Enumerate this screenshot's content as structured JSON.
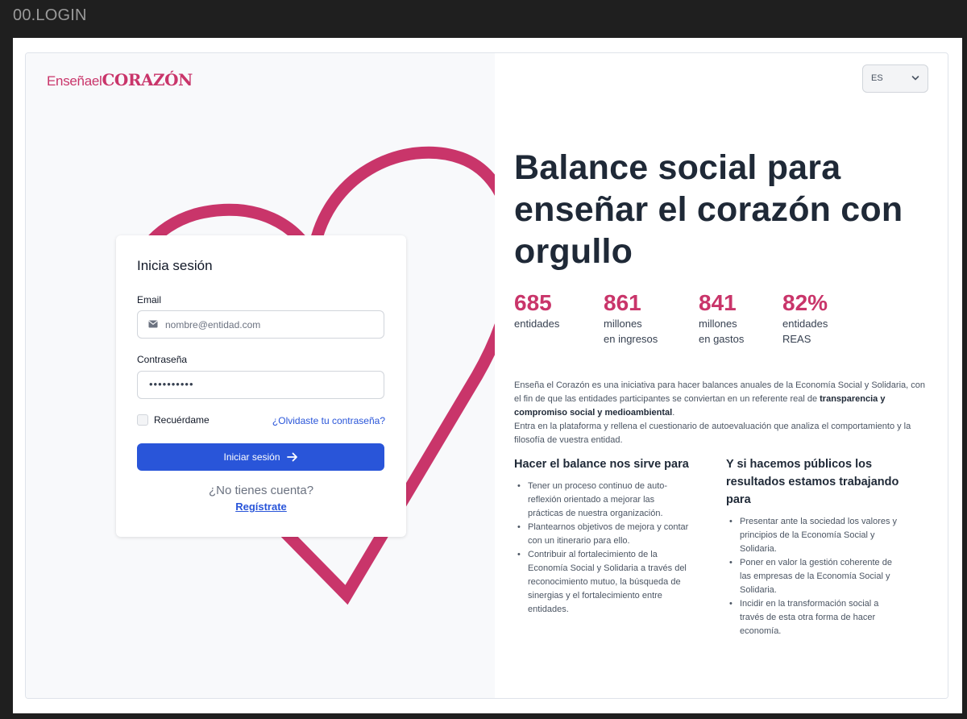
{
  "frame": {
    "title": "00.LOGIN"
  },
  "brand": {
    "logo_part1": "Enseñael",
    "logo_part2": "CORAZÓN",
    "accent": "#c9356a",
    "primary": "#2955d9"
  },
  "language": {
    "value": "ES",
    "icon": "chevron-down-icon"
  },
  "login": {
    "title": "Inicia sesión",
    "email_label": "Email",
    "email_placeholder": "nombre@entidad.com",
    "email_icon": "envelope-icon",
    "password_label": "Contraseña",
    "password_value": "••••••••••",
    "remember_label": "Recuérdame",
    "forgot_link": "¿Olvidaste tu contraseña?",
    "submit_label": "Iniciar sesión",
    "submit_icon": "arrow-right-icon",
    "no_account": "¿No tienes cuenta?",
    "register_link": "Regístrate"
  },
  "hero": {
    "title_lines": [
      "Balance social para",
      "enseñar el corazón con",
      "orgullo"
    ]
  },
  "stats": [
    {
      "value": "685",
      "line1": "entidades",
      "line2": ""
    },
    {
      "value": "861",
      "line1": "millones",
      "line2": "en ingresos"
    },
    {
      "value": "841",
      "line1": "millones",
      "line2": "en gastos"
    },
    {
      "value": "82%",
      "line1": "entidades",
      "line2": "REAS"
    }
  ],
  "intro": {
    "p1_start": "Enseña el Corazón es una iniciativa para hacer balances anuales de la Economía Social y Solidaria, con el fin de que las entidades participantes se conviertan en un referente real de ",
    "p1_bold": "transparencia y compromiso social y medioambiental",
    "p1_end": ".",
    "p2": "Entra en la plataforma y rellena el cuestionario de autoevaluación que analiza el comportamiento y la filosofía de vuestra entidad."
  },
  "col1": {
    "title": "Hacer el balance nos sirve para",
    "items": [
      "Tener un proceso continuo de auto-reflexión orientado a mejorar las prácticas de nuestra organización.",
      "Plantearnos objetivos de mejora y contar con un itinerario para ello.",
      "Contribuir al fortalecimiento de la Economía Social y Solidaria a  través del reconocimiento mutuo, la búsqueda de sinergias y el fortalecimiento entre entidades."
    ]
  },
  "col2": {
    "title": "Y si hacemos públicos los resultados estamos trabajando para",
    "items": [
      "Presentar ante la sociedad los valores y principios de la Economía Social y Solidaria.",
      "Poner en valor la gestión coherente de las empresas de la Economía Social y Solidaria.",
      "Incidir en la transformación social a través de esta otra forma de hacer economía."
    ]
  }
}
